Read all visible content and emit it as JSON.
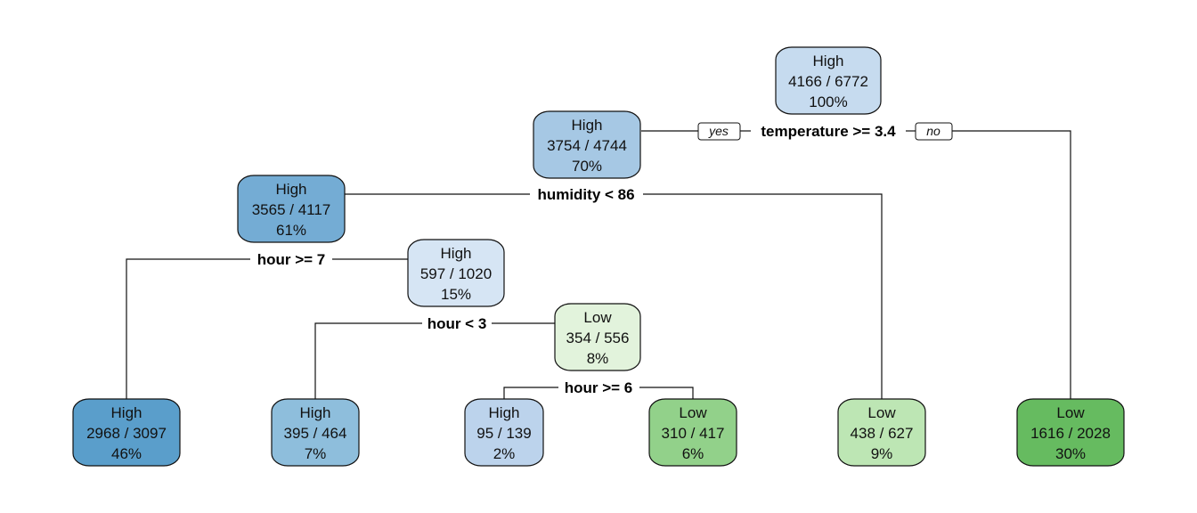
{
  "tree": {
    "nodes": [
      {
        "id": "n1",
        "class": "High",
        "counts": "4166 / 6772",
        "pct": "100%",
        "color": "#c6dbef"
      },
      {
        "id": "n2",
        "class": "High",
        "counts": "3754 / 4744",
        "pct": "70%",
        "color": "#a6c8e4"
      },
      {
        "id": "n3",
        "class": "High",
        "counts": "3565 / 4117",
        "pct": "61%",
        "color": "#74acd4"
      },
      {
        "id": "n4",
        "class": "High",
        "counts": "597 / 1020",
        "pct": "15%",
        "color": "#d6e5f4"
      },
      {
        "id": "n5",
        "class": "Low",
        "counts": "354 / 556",
        "pct": "8%",
        "color": "#e2f3dc"
      },
      {
        "id": "l1",
        "class": "High",
        "counts": "2968 / 3097",
        "pct": "46%",
        "color": "#5a9ecb"
      },
      {
        "id": "l2",
        "class": "High",
        "counts": "395 / 464",
        "pct": "7%",
        "color": "#8ebedc"
      },
      {
        "id": "l3",
        "class": "High",
        "counts": "95 / 139",
        "pct": "2%",
        "color": "#bcd3ec"
      },
      {
        "id": "l4",
        "class": "Low",
        "counts": "310 / 417",
        "pct": "6%",
        "color": "#92d18a"
      },
      {
        "id": "l5",
        "class": "Low",
        "counts": "438 / 627",
        "pct": "9%",
        "color": "#bde6b4"
      },
      {
        "id": "l6",
        "class": "Low",
        "counts": "1616 / 2028",
        "pct": "30%",
        "color": "#66bb60"
      }
    ],
    "splits": [
      {
        "id": "s1",
        "label": "temperature >= 3.4"
      },
      {
        "id": "s2",
        "label": "humidity < 86"
      },
      {
        "id": "s3",
        "label": "hour >= 7"
      },
      {
        "id": "s4",
        "label": "hour < 3"
      },
      {
        "id": "s5",
        "label": "hour >= 6"
      }
    ],
    "branch_labels": {
      "yes": "yes",
      "no": "no"
    }
  }
}
